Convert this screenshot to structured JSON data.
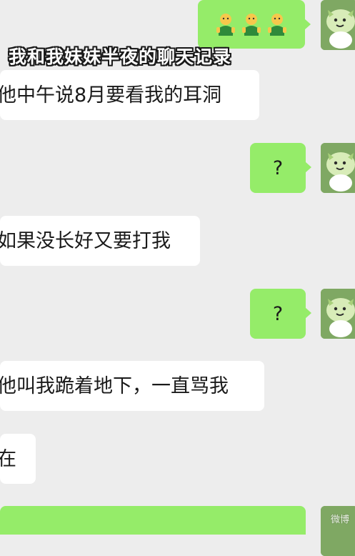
{
  "chat": {
    "messages": [
      {
        "side": "right",
        "type": "emoji",
        "content": "🧑🧑🧑"
      },
      {
        "side": "left",
        "text": "他中午说8月要看我的耳洞"
      },
      {
        "side": "right",
        "text": "?"
      },
      {
        "side": "left",
        "text": "如果没长好又要打我"
      },
      {
        "side": "right",
        "text": "?"
      },
      {
        "side": "left",
        "text": "他叫我跪着地下，一直骂我"
      },
      {
        "side": "left",
        "text": "在"
      }
    ]
  },
  "overlay": {
    "title": "我和我妹妹半夜的聊天记录"
  },
  "watermark": {
    "text": "微博"
  },
  "colors": {
    "background": "#ededed",
    "outgoing_bubble": "#95ec69",
    "incoming_bubble": "#ffffff",
    "avatar": "#7fa863"
  },
  "icons": {
    "avatar": "green-sprite-avatar-icon",
    "emoji": "green-shirt-person-emoji-icon"
  }
}
